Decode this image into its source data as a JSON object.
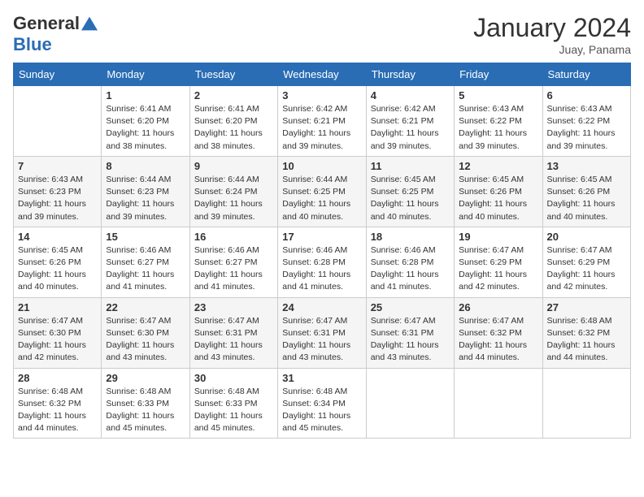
{
  "header": {
    "logo_general": "General",
    "logo_blue": "Blue",
    "month_year": "January 2024",
    "location": "Juay, Panama"
  },
  "weekdays": [
    "Sunday",
    "Monday",
    "Tuesday",
    "Wednesday",
    "Thursday",
    "Friday",
    "Saturday"
  ],
  "weeks": [
    [
      {
        "day": "",
        "sunrise": "",
        "sunset": "",
        "daylight": ""
      },
      {
        "day": "1",
        "sunrise": "Sunrise: 6:41 AM",
        "sunset": "Sunset: 6:20 PM",
        "daylight": "Daylight: 11 hours and 38 minutes."
      },
      {
        "day": "2",
        "sunrise": "Sunrise: 6:41 AM",
        "sunset": "Sunset: 6:20 PM",
        "daylight": "Daylight: 11 hours and 38 minutes."
      },
      {
        "day": "3",
        "sunrise": "Sunrise: 6:42 AM",
        "sunset": "Sunset: 6:21 PM",
        "daylight": "Daylight: 11 hours and 39 minutes."
      },
      {
        "day": "4",
        "sunrise": "Sunrise: 6:42 AM",
        "sunset": "Sunset: 6:21 PM",
        "daylight": "Daylight: 11 hours and 39 minutes."
      },
      {
        "day": "5",
        "sunrise": "Sunrise: 6:43 AM",
        "sunset": "Sunset: 6:22 PM",
        "daylight": "Daylight: 11 hours and 39 minutes."
      },
      {
        "day": "6",
        "sunrise": "Sunrise: 6:43 AM",
        "sunset": "Sunset: 6:22 PM",
        "daylight": "Daylight: 11 hours and 39 minutes."
      }
    ],
    [
      {
        "day": "7",
        "sunrise": "Sunrise: 6:43 AM",
        "sunset": "Sunset: 6:23 PM",
        "daylight": "Daylight: 11 hours and 39 minutes."
      },
      {
        "day": "8",
        "sunrise": "Sunrise: 6:44 AM",
        "sunset": "Sunset: 6:23 PM",
        "daylight": "Daylight: 11 hours and 39 minutes."
      },
      {
        "day": "9",
        "sunrise": "Sunrise: 6:44 AM",
        "sunset": "Sunset: 6:24 PM",
        "daylight": "Daylight: 11 hours and 39 minutes."
      },
      {
        "day": "10",
        "sunrise": "Sunrise: 6:44 AM",
        "sunset": "Sunset: 6:25 PM",
        "daylight": "Daylight: 11 hours and 40 minutes."
      },
      {
        "day": "11",
        "sunrise": "Sunrise: 6:45 AM",
        "sunset": "Sunset: 6:25 PM",
        "daylight": "Daylight: 11 hours and 40 minutes."
      },
      {
        "day": "12",
        "sunrise": "Sunrise: 6:45 AM",
        "sunset": "Sunset: 6:26 PM",
        "daylight": "Daylight: 11 hours and 40 minutes."
      },
      {
        "day": "13",
        "sunrise": "Sunrise: 6:45 AM",
        "sunset": "Sunset: 6:26 PM",
        "daylight": "Daylight: 11 hours and 40 minutes."
      }
    ],
    [
      {
        "day": "14",
        "sunrise": "Sunrise: 6:45 AM",
        "sunset": "Sunset: 6:26 PM",
        "daylight": "Daylight: 11 hours and 40 minutes."
      },
      {
        "day": "15",
        "sunrise": "Sunrise: 6:46 AM",
        "sunset": "Sunset: 6:27 PM",
        "daylight": "Daylight: 11 hours and 41 minutes."
      },
      {
        "day": "16",
        "sunrise": "Sunrise: 6:46 AM",
        "sunset": "Sunset: 6:27 PM",
        "daylight": "Daylight: 11 hours and 41 minutes."
      },
      {
        "day": "17",
        "sunrise": "Sunrise: 6:46 AM",
        "sunset": "Sunset: 6:28 PM",
        "daylight": "Daylight: 11 hours and 41 minutes."
      },
      {
        "day": "18",
        "sunrise": "Sunrise: 6:46 AM",
        "sunset": "Sunset: 6:28 PM",
        "daylight": "Daylight: 11 hours and 41 minutes."
      },
      {
        "day": "19",
        "sunrise": "Sunrise: 6:47 AM",
        "sunset": "Sunset: 6:29 PM",
        "daylight": "Daylight: 11 hours and 42 minutes."
      },
      {
        "day": "20",
        "sunrise": "Sunrise: 6:47 AM",
        "sunset": "Sunset: 6:29 PM",
        "daylight": "Daylight: 11 hours and 42 minutes."
      }
    ],
    [
      {
        "day": "21",
        "sunrise": "Sunrise: 6:47 AM",
        "sunset": "Sunset: 6:30 PM",
        "daylight": "Daylight: 11 hours and 42 minutes."
      },
      {
        "day": "22",
        "sunrise": "Sunrise: 6:47 AM",
        "sunset": "Sunset: 6:30 PM",
        "daylight": "Daylight: 11 hours and 43 minutes."
      },
      {
        "day": "23",
        "sunrise": "Sunrise: 6:47 AM",
        "sunset": "Sunset: 6:31 PM",
        "daylight": "Daylight: 11 hours and 43 minutes."
      },
      {
        "day": "24",
        "sunrise": "Sunrise: 6:47 AM",
        "sunset": "Sunset: 6:31 PM",
        "daylight": "Daylight: 11 hours and 43 minutes."
      },
      {
        "day": "25",
        "sunrise": "Sunrise: 6:47 AM",
        "sunset": "Sunset: 6:31 PM",
        "daylight": "Daylight: 11 hours and 43 minutes."
      },
      {
        "day": "26",
        "sunrise": "Sunrise: 6:47 AM",
        "sunset": "Sunset: 6:32 PM",
        "daylight": "Daylight: 11 hours and 44 minutes."
      },
      {
        "day": "27",
        "sunrise": "Sunrise: 6:48 AM",
        "sunset": "Sunset: 6:32 PM",
        "daylight": "Daylight: 11 hours and 44 minutes."
      }
    ],
    [
      {
        "day": "28",
        "sunrise": "Sunrise: 6:48 AM",
        "sunset": "Sunset: 6:32 PM",
        "daylight": "Daylight: 11 hours and 44 minutes."
      },
      {
        "day": "29",
        "sunrise": "Sunrise: 6:48 AM",
        "sunset": "Sunset: 6:33 PM",
        "daylight": "Daylight: 11 hours and 45 minutes."
      },
      {
        "day": "30",
        "sunrise": "Sunrise: 6:48 AM",
        "sunset": "Sunset: 6:33 PM",
        "daylight": "Daylight: 11 hours and 45 minutes."
      },
      {
        "day": "31",
        "sunrise": "Sunrise: 6:48 AM",
        "sunset": "Sunset: 6:34 PM",
        "daylight": "Daylight: 11 hours and 45 minutes."
      },
      {
        "day": "",
        "sunrise": "",
        "sunset": "",
        "daylight": ""
      },
      {
        "day": "",
        "sunrise": "",
        "sunset": "",
        "daylight": ""
      },
      {
        "day": "",
        "sunrise": "",
        "sunset": "",
        "daylight": ""
      }
    ]
  ]
}
